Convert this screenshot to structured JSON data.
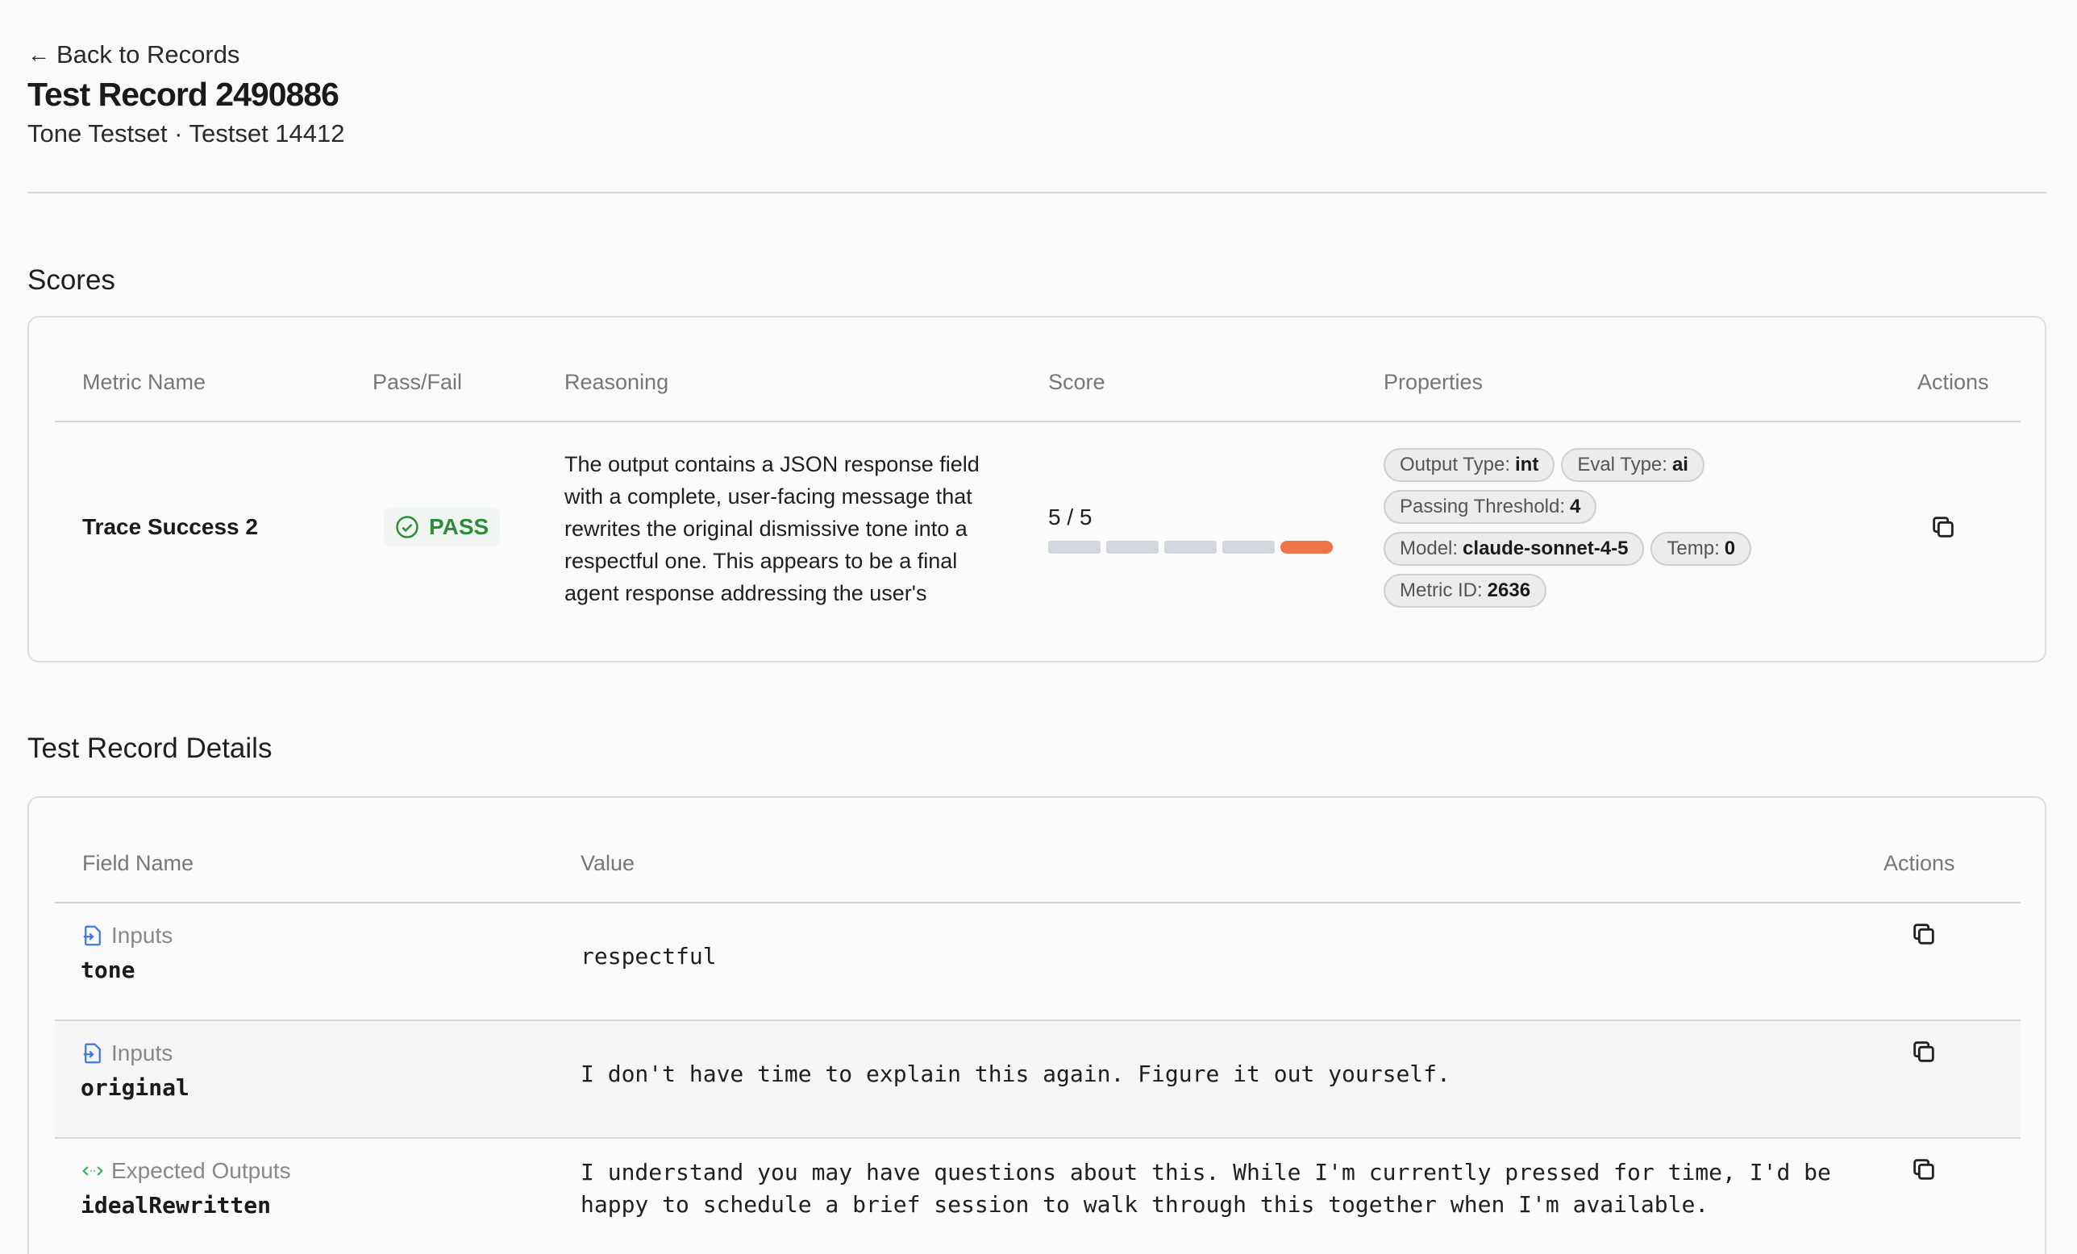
{
  "header": {
    "back_label": "Back to Records",
    "title": "Test Record 2490886",
    "subtitle": "Tone Testset · Testset 14412"
  },
  "scores": {
    "section_title": "Scores",
    "columns": {
      "metric": "Metric Name",
      "passfail": "Pass/Fail",
      "reasoning": "Reasoning",
      "score": "Score",
      "properties": "Properties",
      "actions": "Actions"
    },
    "row": {
      "metric_name": "Trace Success 2",
      "status": "PASS",
      "reasoning": "The output contains a JSON response field with a complete, user-facing message that rewrites the original dismissive tone into a respectful one. This appears to be a final agent response addressing the user's",
      "score_text": "5 / 5",
      "score_value": 5,
      "score_max": 5,
      "props": {
        "output_type_label": "Output Type:",
        "output_type": "int",
        "eval_type_label": "Eval Type:",
        "eval_type": "ai",
        "threshold_label": "Passing Threshold:",
        "threshold": "4",
        "model_label": "Model:",
        "model": "claude-sonnet-4-5",
        "temp_label": "Temp:",
        "temp": "0",
        "metric_id_label": "Metric ID:",
        "metric_id": "2636"
      }
    }
  },
  "details": {
    "section_title": "Test Record Details",
    "columns": {
      "field": "Field Name",
      "value": "Value",
      "actions": "Actions"
    },
    "rows": [
      {
        "type": "Inputs",
        "key": "tone",
        "value": "respectful"
      },
      {
        "type": "Inputs",
        "key": "original",
        "value": "I don't have time to explain this again. Figure it out yourself."
      },
      {
        "type": "Expected Outputs",
        "key": "idealRewritten",
        "value": "I understand you may have questions about this. While I'm currently pressed for time, I'd be happy to schedule a brief session to walk through this together when I'm available."
      }
    ]
  },
  "colors": {
    "pass": "#2e8b3e",
    "score_active": "#ee744a",
    "score_inactive": "#d4d8de",
    "input_icon": "#3b78e7",
    "output_icon": "#3fb34f"
  }
}
